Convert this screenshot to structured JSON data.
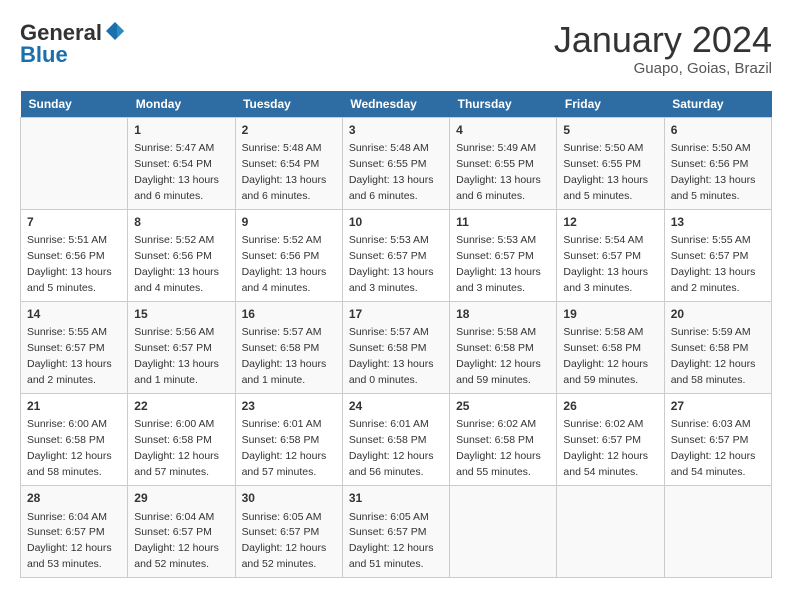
{
  "header": {
    "logo_general": "General",
    "logo_blue": "Blue",
    "title": "January 2024",
    "location": "Guapo, Goias, Brazil"
  },
  "weekdays": [
    "Sunday",
    "Monday",
    "Tuesday",
    "Wednesday",
    "Thursday",
    "Friday",
    "Saturday"
  ],
  "weeks": [
    [
      {
        "day": "",
        "info": ""
      },
      {
        "day": "1",
        "info": "Sunrise: 5:47 AM\nSunset: 6:54 PM\nDaylight: 13 hours and 6 minutes."
      },
      {
        "day": "2",
        "info": "Sunrise: 5:48 AM\nSunset: 6:54 PM\nDaylight: 13 hours and 6 minutes."
      },
      {
        "day": "3",
        "info": "Sunrise: 5:48 AM\nSunset: 6:55 PM\nDaylight: 13 hours and 6 minutes."
      },
      {
        "day": "4",
        "info": "Sunrise: 5:49 AM\nSunset: 6:55 PM\nDaylight: 13 hours and 6 minutes."
      },
      {
        "day": "5",
        "info": "Sunrise: 5:50 AM\nSunset: 6:55 PM\nDaylight: 13 hours and 5 minutes."
      },
      {
        "day": "6",
        "info": "Sunrise: 5:50 AM\nSunset: 6:56 PM\nDaylight: 13 hours and 5 minutes."
      }
    ],
    [
      {
        "day": "7",
        "info": "Sunrise: 5:51 AM\nSunset: 6:56 PM\nDaylight: 13 hours and 5 minutes."
      },
      {
        "day": "8",
        "info": "Sunrise: 5:52 AM\nSunset: 6:56 PM\nDaylight: 13 hours and 4 minutes."
      },
      {
        "day": "9",
        "info": "Sunrise: 5:52 AM\nSunset: 6:56 PM\nDaylight: 13 hours and 4 minutes."
      },
      {
        "day": "10",
        "info": "Sunrise: 5:53 AM\nSunset: 6:57 PM\nDaylight: 13 hours and 3 minutes."
      },
      {
        "day": "11",
        "info": "Sunrise: 5:53 AM\nSunset: 6:57 PM\nDaylight: 13 hours and 3 minutes."
      },
      {
        "day": "12",
        "info": "Sunrise: 5:54 AM\nSunset: 6:57 PM\nDaylight: 13 hours and 3 minutes."
      },
      {
        "day": "13",
        "info": "Sunrise: 5:55 AM\nSunset: 6:57 PM\nDaylight: 13 hours and 2 minutes."
      }
    ],
    [
      {
        "day": "14",
        "info": "Sunrise: 5:55 AM\nSunset: 6:57 PM\nDaylight: 13 hours and 2 minutes."
      },
      {
        "day": "15",
        "info": "Sunrise: 5:56 AM\nSunset: 6:57 PM\nDaylight: 13 hours and 1 minute."
      },
      {
        "day": "16",
        "info": "Sunrise: 5:57 AM\nSunset: 6:58 PM\nDaylight: 13 hours and 1 minute."
      },
      {
        "day": "17",
        "info": "Sunrise: 5:57 AM\nSunset: 6:58 PM\nDaylight: 13 hours and 0 minutes."
      },
      {
        "day": "18",
        "info": "Sunrise: 5:58 AM\nSunset: 6:58 PM\nDaylight: 12 hours and 59 minutes."
      },
      {
        "day": "19",
        "info": "Sunrise: 5:58 AM\nSunset: 6:58 PM\nDaylight: 12 hours and 59 minutes."
      },
      {
        "day": "20",
        "info": "Sunrise: 5:59 AM\nSunset: 6:58 PM\nDaylight: 12 hours and 58 minutes."
      }
    ],
    [
      {
        "day": "21",
        "info": "Sunrise: 6:00 AM\nSunset: 6:58 PM\nDaylight: 12 hours and 58 minutes."
      },
      {
        "day": "22",
        "info": "Sunrise: 6:00 AM\nSunset: 6:58 PM\nDaylight: 12 hours and 57 minutes."
      },
      {
        "day": "23",
        "info": "Sunrise: 6:01 AM\nSunset: 6:58 PM\nDaylight: 12 hours and 57 minutes."
      },
      {
        "day": "24",
        "info": "Sunrise: 6:01 AM\nSunset: 6:58 PM\nDaylight: 12 hours and 56 minutes."
      },
      {
        "day": "25",
        "info": "Sunrise: 6:02 AM\nSunset: 6:58 PM\nDaylight: 12 hours and 55 minutes."
      },
      {
        "day": "26",
        "info": "Sunrise: 6:02 AM\nSunset: 6:57 PM\nDaylight: 12 hours and 54 minutes."
      },
      {
        "day": "27",
        "info": "Sunrise: 6:03 AM\nSunset: 6:57 PM\nDaylight: 12 hours and 54 minutes."
      }
    ],
    [
      {
        "day": "28",
        "info": "Sunrise: 6:04 AM\nSunset: 6:57 PM\nDaylight: 12 hours and 53 minutes."
      },
      {
        "day": "29",
        "info": "Sunrise: 6:04 AM\nSunset: 6:57 PM\nDaylight: 12 hours and 52 minutes."
      },
      {
        "day": "30",
        "info": "Sunrise: 6:05 AM\nSunset: 6:57 PM\nDaylight: 12 hours and 52 minutes."
      },
      {
        "day": "31",
        "info": "Sunrise: 6:05 AM\nSunset: 6:57 PM\nDaylight: 12 hours and 51 minutes."
      },
      {
        "day": "",
        "info": ""
      },
      {
        "day": "",
        "info": ""
      },
      {
        "day": "",
        "info": ""
      }
    ]
  ]
}
